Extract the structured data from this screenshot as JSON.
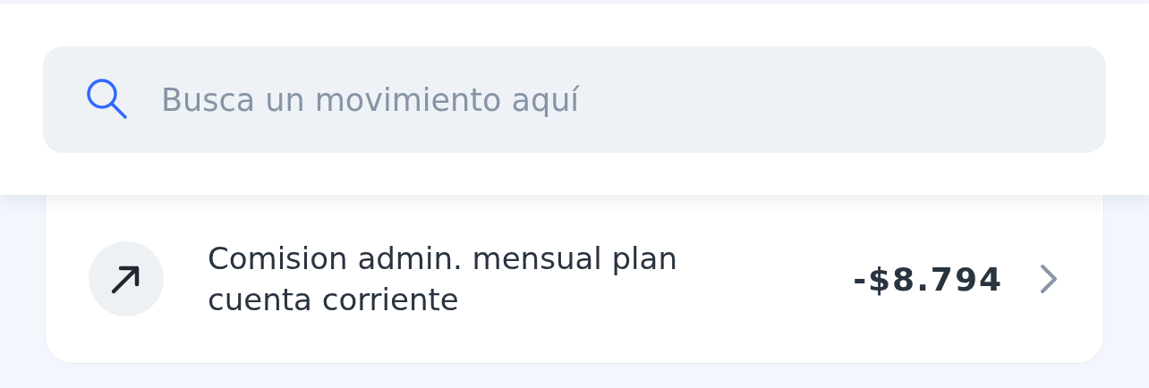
{
  "search": {
    "placeholder": "Busca un movimiento aquí"
  },
  "movements": [
    {
      "description": "Comision admin. mensual plan cuenta corriente",
      "amount": "-$8.794"
    }
  ]
}
